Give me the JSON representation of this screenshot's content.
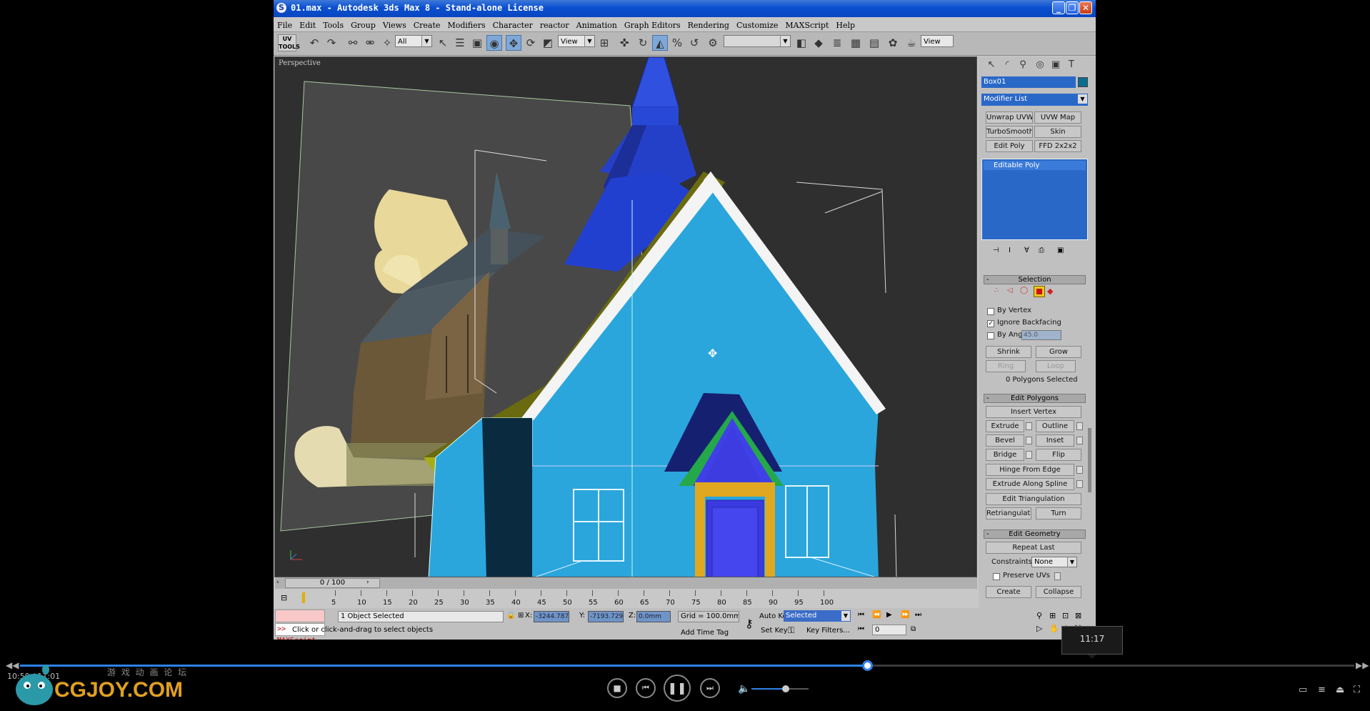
{
  "window": {
    "title": "01.max - Autodesk 3ds Max 8 - Stand-alone License",
    "app_icon": "max-logo-icon",
    "controls": [
      "minimize",
      "restore",
      "close"
    ]
  },
  "menu": [
    "File",
    "Edit",
    "Tools",
    "Group",
    "Views",
    "Create",
    "Modifiers",
    "Character",
    "reactor",
    "Animation",
    "Graph Editors",
    "Rendering",
    "Customize",
    "MAXScript",
    "Help"
  ],
  "toolbar": {
    "uv_tools": "UV TOOLS",
    "selection_filter": "All",
    "coord_system": "View",
    "coord_system_2": "View",
    "named_selection": ""
  },
  "viewport": {
    "label": "Perspective",
    "bg_color": "#2f2f2f",
    "model_color": "#2aa6dc"
  },
  "command_panel": {
    "object_name": "Box01",
    "object_color": "#0a6e8e",
    "modifier_list": "Modifier List",
    "modifier_buttons": [
      "Unwrap UVW",
      "UVW Map",
      "TurboSmooth",
      "Skin",
      "Edit Poly",
      "FFD 2x2x2"
    ],
    "stack": [
      "Editable Poly"
    ],
    "selection": {
      "title": "Selection",
      "by_vertex": "By Vertex",
      "ignore_backfacing": "Ignore Backfacing",
      "ignore_backfacing_checked": true,
      "by_angle": "By Angle:",
      "by_angle_value": "45.0",
      "shrink": "Shrink",
      "grow": "Grow",
      "ring": "Ring",
      "loop": "Loop",
      "status": "0 Polygons Selected"
    },
    "edit_polygons": {
      "title": "Edit Polygons",
      "insert_vertex": "Insert Vertex",
      "extrude": "Extrude",
      "outline": "Outline",
      "bevel": "Bevel",
      "inset": "Inset",
      "bridge": "Bridge",
      "flip": "Flip",
      "hinge": "Hinge From Edge",
      "extrude_spline": "Extrude Along Spline",
      "edit_triangulation": "Edit Triangulation",
      "retriangulate": "Retriangulate",
      "turn": "Turn"
    },
    "edit_geometry": {
      "title": "Edit Geometry",
      "repeat_last": "Repeat Last",
      "constraints_label": "Constraints:",
      "constraints_value": "None",
      "preserve_uvs": "Preserve UVs",
      "create": "Create",
      "collapse": "Collapse"
    }
  },
  "timeline": {
    "frame": "0 / 100",
    "ticks": [
      "5",
      "10",
      "15",
      "20",
      "25",
      "30",
      "35",
      "40",
      "45",
      "50",
      "55",
      "60",
      "65",
      "70",
      "75",
      "80",
      "85",
      "90",
      "95",
      "100"
    ]
  },
  "status": {
    "maxscript": ">> MAXScript",
    "selected": "1 Object Selected",
    "prompt": "Click or click-and-drag to select objects",
    "x_label": "X:",
    "x_value": "-3244.787r",
    "y_label": "Y:",
    "y_value": "-7193.729r",
    "z_label": "Z:",
    "z_value": "0.0mm",
    "grid": "Grid = 100.0mm",
    "add_time_tag": "Add Time Tag",
    "auto_key": "Auto Key",
    "auto_key_mode": "Selected",
    "set_key": "Set Key",
    "key_filters": "Key Filters...",
    "current_frame": "0"
  },
  "player": {
    "tooltip_time": "11:17",
    "elapsed": "10:59 / 11:01",
    "progress_fraction": 0.635,
    "volume_fraction": 0.6,
    "brand": "CGJOY.COM",
    "brand_sub": "游 戏 动 画 论 坛",
    "accent": "#2c82e8"
  }
}
